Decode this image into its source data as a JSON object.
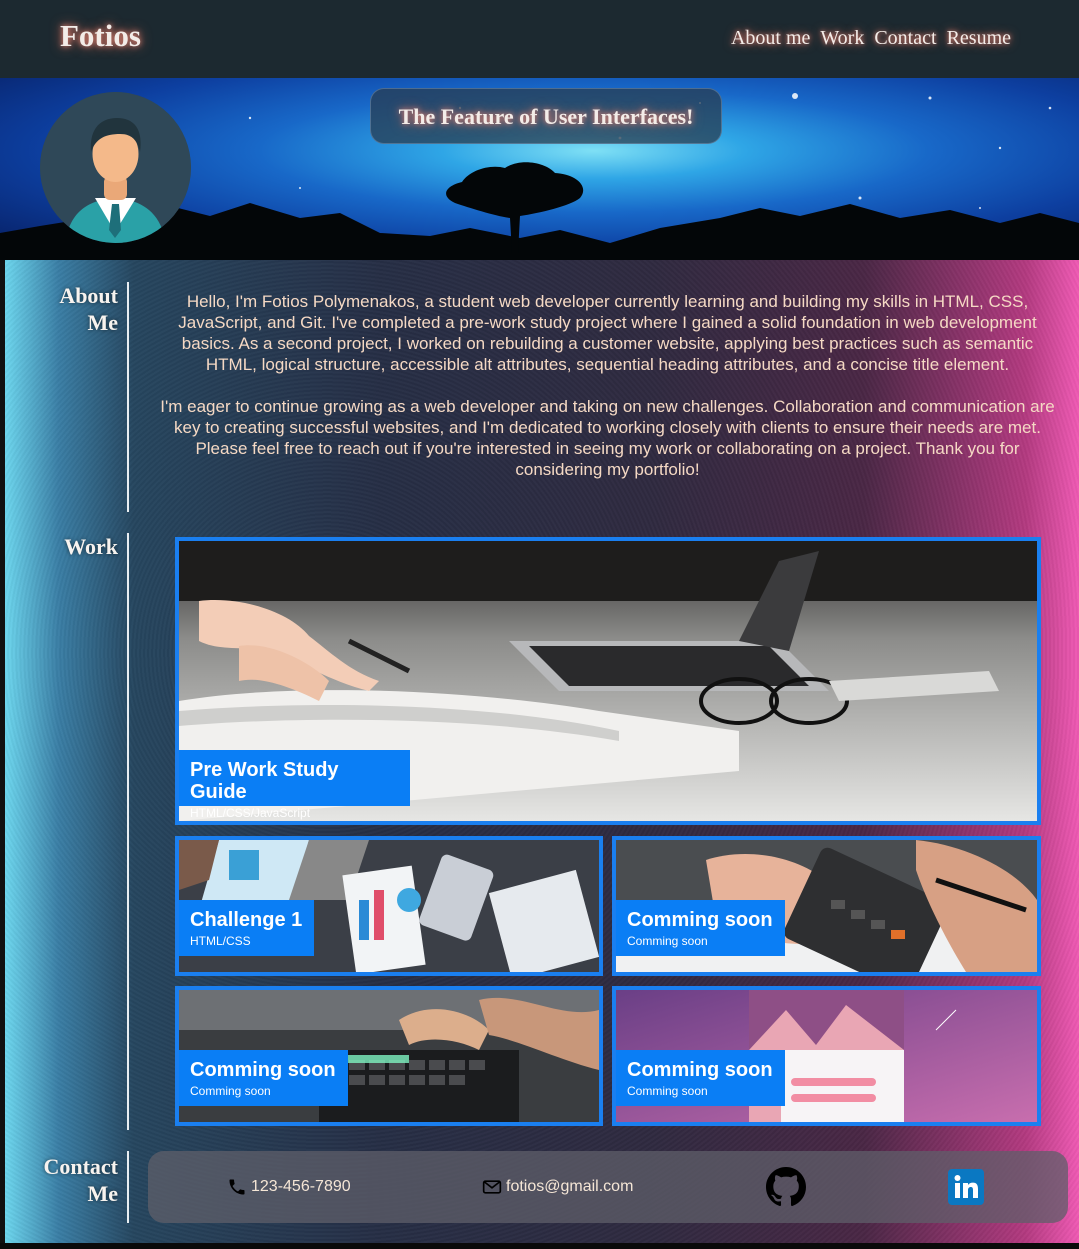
{
  "header": {
    "logo": "Fotios",
    "nav": [
      "About me",
      "Work",
      "Contact",
      "Resume"
    ]
  },
  "hero": {
    "title": "The Feature of User Interfaces!",
    "avatar_icon": "businessman-avatar-icon"
  },
  "about": {
    "label_line1": "About",
    "label_line2": "Me",
    "paragraphs": [
      "Hello, I'm Fotios Polymenakos, a student web developer currently learning and building my skills in HTML, CSS, JavaScript, and Git. I've completed a pre-work study project where I gained a solid foundation in web development basics. As a second project, I worked on rebuilding a customer website, applying best practices such as semantic HTML, logical structure, accessible alt attributes, sequential heading attributes, and a concise title element.",
      "I'm eager to continue growing as a web developer and taking on new challenges. Collaboration and communication are key to creating successful websites, and I'm dedicated to working closely with clients to ensure their needs are met. Please feel free to reach out if you're interested in seeing my work or collaborating on a project. Thank you for considering my portfolio!"
    ]
  },
  "work": {
    "label": "Work",
    "cards": [
      {
        "title": "Pre Work Study Guide",
        "subtitle": "HTML/CSS/JavaScript"
      },
      {
        "title": "Challenge 1",
        "subtitle": "HTML/CSS"
      },
      {
        "title": "Comming soon",
        "subtitle": "Comming soon"
      },
      {
        "title": "Comming soon",
        "subtitle": "Comming soon"
      },
      {
        "title": "Comming soon",
        "subtitle": "Comming soon"
      }
    ]
  },
  "contact": {
    "label_line1": "Contact",
    "label_line2": "Me",
    "phone": "123-456-7890",
    "email": "fotios@gmail.com",
    "github_icon": "github-icon",
    "linkedin_icon": "linkedin-icon"
  },
  "colors": {
    "header_bg": "#1c2930",
    "accent_blue": "#0a7ef5",
    "text_peach": "#f5d9c4"
  }
}
